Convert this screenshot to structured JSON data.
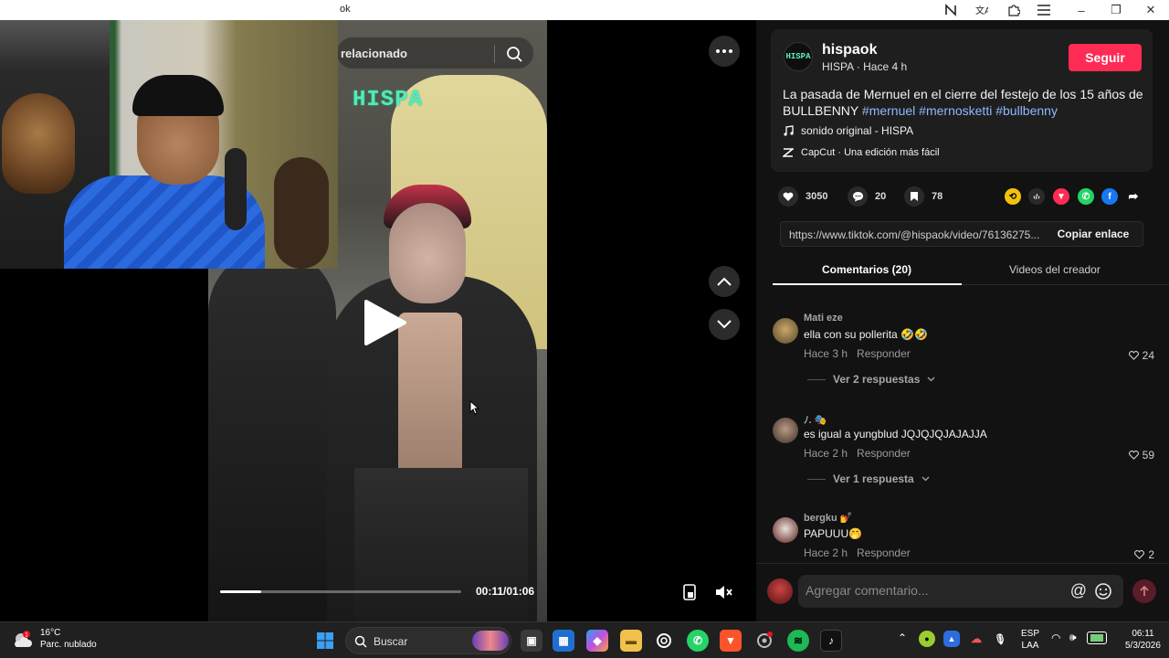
{
  "browser": {
    "tab_text": "ok",
    "window_controls": {
      "minimize": "–",
      "maximize": "❐",
      "close": "✕"
    }
  },
  "video": {
    "search_text": "relacionado",
    "watermark": "HISPA",
    "current_time": "00:11/01:06",
    "progress": 0.17
  },
  "post": {
    "avatar_text": "HISPA",
    "username": "hispaok",
    "subline": "HISPA · Hace 4 h",
    "follow_label": "Seguir",
    "description": "La pasada de Mernuel en el cierre del festejo de los 15 años de BULLBENNY ",
    "hashtags": [
      "#mernuel",
      "#mernosketti",
      "#bullbenny"
    ],
    "sound": "sonido original - HISPA",
    "capcut": "CapCut · Una edición más fácil"
  },
  "actions": {
    "likes": "3050",
    "comments": "20",
    "saves": "78"
  },
  "link": {
    "url": "https://www.tiktok.com/@hispaok/video/76136275...",
    "copy_label": "Copiar enlace"
  },
  "tabs": {
    "comments": "Comentarios (20)",
    "creator_videos": "Videos del creador"
  },
  "comments": [
    {
      "name": "Mati eze",
      "text": "ella con su pollerita 🤣🤣",
      "time": "Hace 3 h",
      "reply": "Responder",
      "likes": "24",
      "replies": "Ver 2 respuestas"
    },
    {
      "name": "ﾉ. 🎭",
      "text": "es igual a yungblud JQJQJQJAJAJJA",
      "time": "Hace 2 h",
      "reply": "Responder",
      "likes": "59",
      "replies": "Ver 1 respuesta"
    },
    {
      "name": "bergku 💅",
      "text": "PAPUUU🤭",
      "time": "Hace 2 h",
      "reply": "Responder",
      "likes": "2"
    }
  ],
  "add_comment": {
    "placeholder": "Agregar comentario...",
    "at": "@"
  },
  "taskbar": {
    "temp": "16°C",
    "weather": "Parc. nublado",
    "weather_badge": "1",
    "search_label": "Buscar",
    "lang_top": "ESP",
    "lang_bottom": "LAA",
    "time": "06:11",
    "date": "5/3/2026"
  },
  "colors": {
    "accent": "#fe2c55",
    "hashtag": "#8fb8ff",
    "panel_bg": "#121212"
  }
}
